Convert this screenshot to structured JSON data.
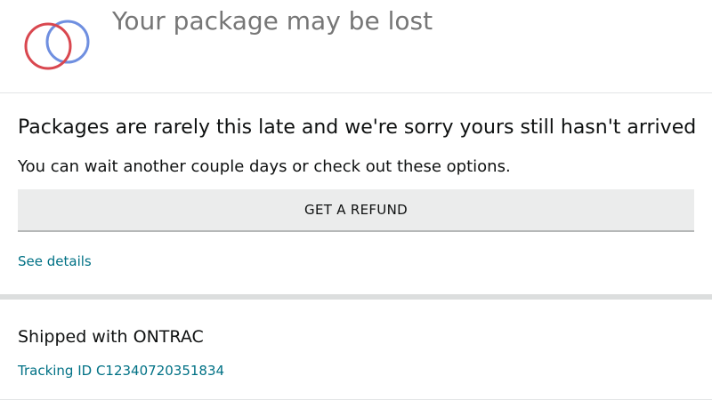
{
  "header": {
    "logo_icon": "overlapping-rings-icon",
    "logo_colors": {
      "red_ring": "#d9474f",
      "blue_ring": "#6f8fe0"
    },
    "title": "Your package may be lost"
  },
  "message": {
    "headline": "Packages are rarely this late and we're sorry yours still hasn't arrived",
    "subtext": "You can wait another couple days or check out these options.",
    "refund_button_label": "GET A REFUND",
    "see_details_link": "See details"
  },
  "shipping": {
    "carrier_text": "Shipped with ONTRAC",
    "tracking_text": "Tracking ID C12340720351834"
  },
  "colors": {
    "link": "#007185",
    "text": "#0f1111",
    "title_gray": "#767676",
    "button_bg": "#ebecec"
  }
}
